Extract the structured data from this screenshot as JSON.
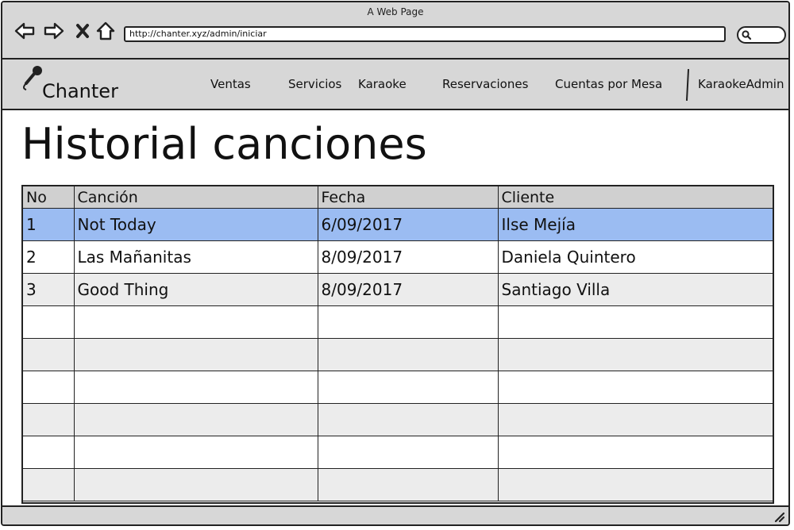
{
  "browser": {
    "title": "A Web Page",
    "url": "http://chanter.xyz/admin/iniciar"
  },
  "app": {
    "logo_text": "Chanter",
    "nav": [
      {
        "label": "Ventas"
      },
      {
        "label": "Servicios"
      },
      {
        "label": "Karaoke"
      },
      {
        "label": "Reservaciones"
      },
      {
        "label": "Cuentas por Mesa"
      }
    ],
    "user_label": "KaraokeAdmin"
  },
  "page": {
    "title": "Historial canciones"
  },
  "table": {
    "headers": [
      "No",
      "Canción",
      "Fecha",
      "Cliente"
    ],
    "rows": [
      [
        "1",
        "Not Today",
        "6/09/2017",
        "Ilse Mejía"
      ],
      [
        "2",
        "Las Mañanitas",
        "8/09/2017",
        "Daniela Quintero"
      ],
      [
        "3",
        "Good Thing",
        "8/09/2017",
        "Santiago Villa"
      ],
      [
        "",
        "",
        "",
        ""
      ],
      [
        "",
        "",
        "",
        ""
      ],
      [
        "",
        "",
        "",
        ""
      ],
      [
        "",
        "",
        "",
        ""
      ],
      [
        "",
        "",
        "",
        ""
      ],
      [
        "",
        "",
        "",
        ""
      ]
    ],
    "selected_row": 0
  },
  "icons": {
    "back": "back-arrow-icon",
    "forward": "forward-arrow-icon",
    "stop": "close-icon",
    "home": "home-icon",
    "search": "search-icon",
    "logo": "microphone-icon",
    "resize": "resize-grip-icon"
  },
  "colors": {
    "chrome": "#d7d7d7",
    "header_row": "#d0d0d0",
    "stripe": "#ececec",
    "selection": "#9bbcf2"
  }
}
